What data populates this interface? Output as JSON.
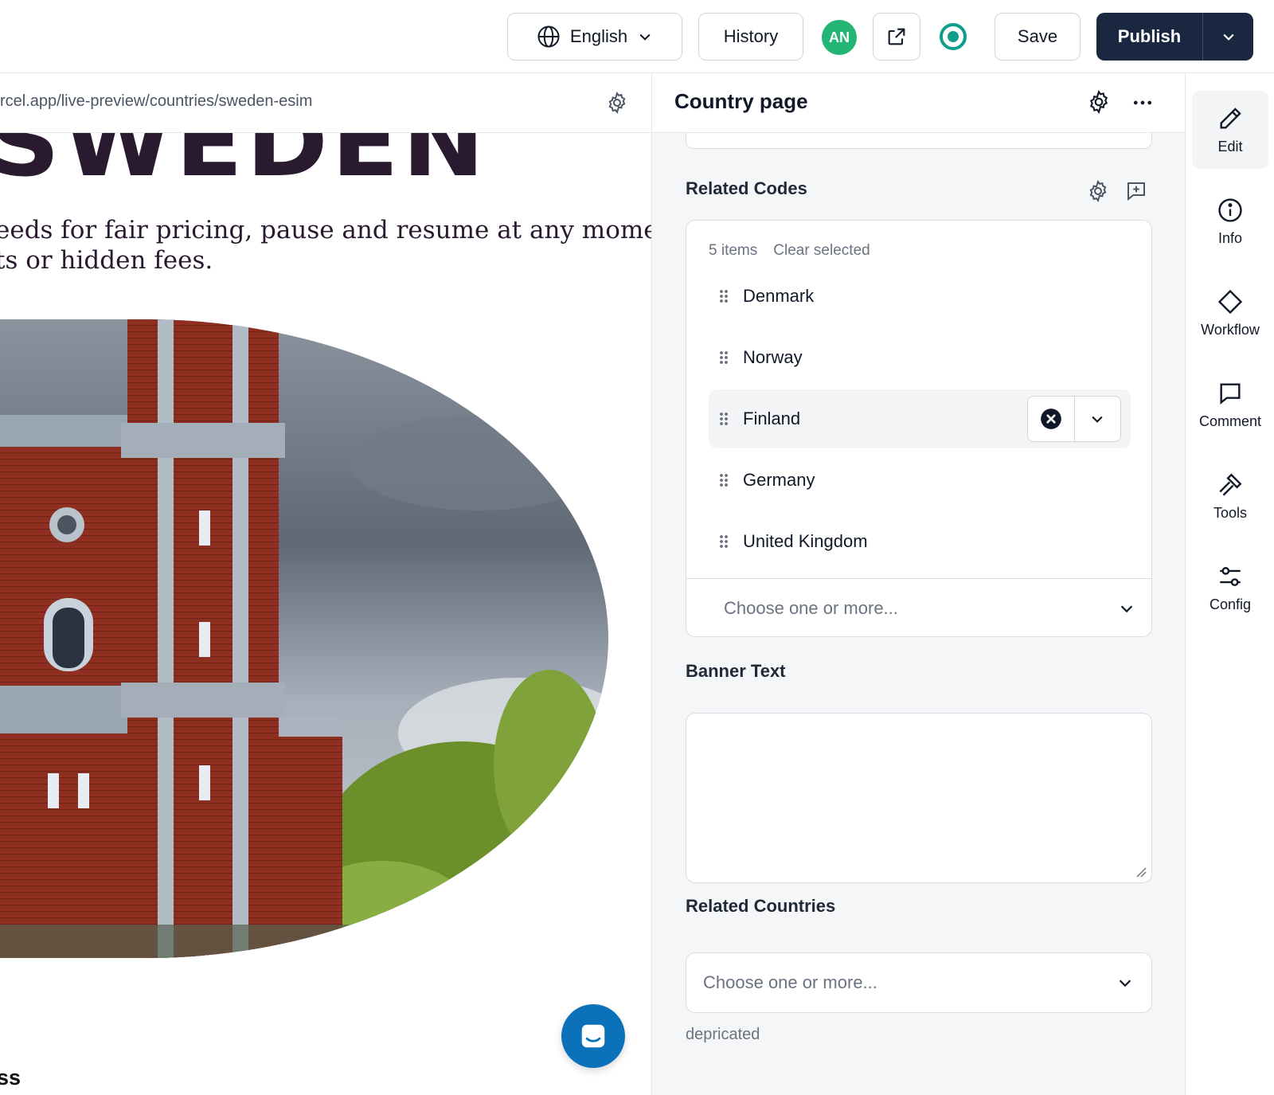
{
  "topbar": {
    "language": "English",
    "history_label": "History",
    "avatar_initials": "AN",
    "save_label": "Save",
    "publish_label": "Publish"
  },
  "preview": {
    "url": "rcel.app/live-preview/countries/sweden-esim",
    "hero_title": "SWEDEN",
    "hero_sub_line1": "eeds for fair pricing, pause and resume at any moment",
    "hero_sub_line2": "ts or hidden fees.",
    "bottom_text": "ss"
  },
  "editor": {
    "title": "Country page",
    "related_codes": {
      "label": "Related Codes",
      "count_text": "5 items",
      "clear_label": "Clear selected",
      "items": [
        "Denmark",
        "Norway",
        "Finland",
        "Germany",
        "United Kingdom"
      ],
      "active_item": "Finland",
      "placeholder": "Choose one or more..."
    },
    "banner_text": {
      "label": "Banner Text",
      "value": ""
    },
    "related_countries": {
      "label": "Related Countries",
      "placeholder": "Choose one or more...",
      "help": "depricated"
    }
  },
  "rail": {
    "items": [
      {
        "label": "Edit",
        "icon": "pencil-icon"
      },
      {
        "label": "Info",
        "icon": "info-icon"
      },
      {
        "label": "Workflow",
        "icon": "diamond-icon"
      },
      {
        "label": "Comment",
        "icon": "comment-icon"
      },
      {
        "label": "Tools",
        "icon": "hammer-icon"
      },
      {
        "label": "Config",
        "icon": "sliders-icon"
      }
    ]
  },
  "colors": {
    "publish_bg": "#1a2740",
    "avatar_bg": "#22b573",
    "status": "#0f9d8c",
    "chat_fab": "#0b72b9",
    "hero_text": "#2a1a30"
  }
}
